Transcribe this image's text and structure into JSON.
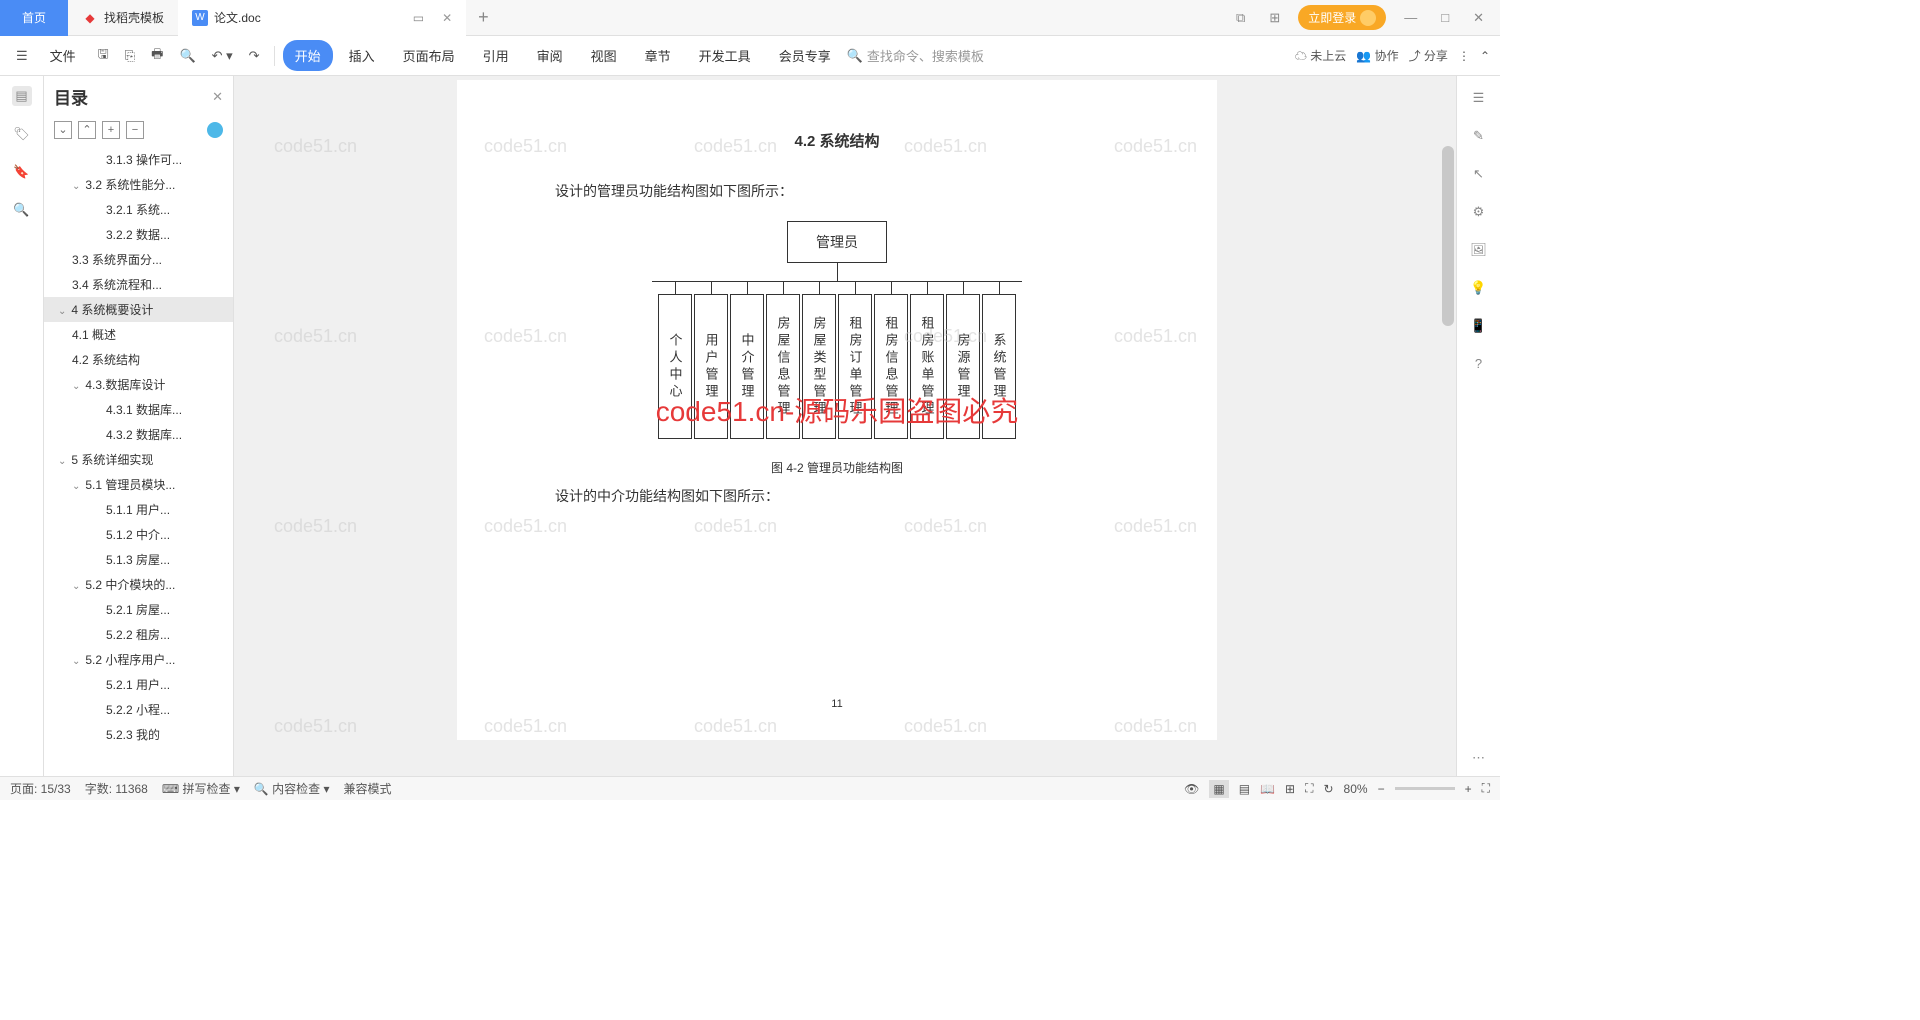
{
  "tabs": {
    "home": "首页",
    "t1": "找稻壳模板",
    "t2": "论文.doc"
  },
  "titleRight": {
    "login": "立即登录"
  },
  "menu": {
    "file": "文件",
    "start": "开始",
    "insert": "插入",
    "layout": "页面布局",
    "ref": "引用",
    "review": "审阅",
    "view": "视图",
    "chapter": "章节",
    "dev": "开发工具",
    "member": "会员专享",
    "search": "查找命令、搜索模板",
    "cloud": "未上云",
    "collab": "协作",
    "share": "分享"
  },
  "outline": {
    "title": "目录"
  },
  "toc": [
    {
      "lv": 4,
      "t": "3.1.3 操作可..."
    },
    {
      "lv": 2,
      "t": "3.2 系统性能分...",
      "c": 1
    },
    {
      "lv": 4,
      "t": "3.2.1 系统..."
    },
    {
      "lv": 4,
      "t": "3.2.2 数据..."
    },
    {
      "lv": 2,
      "t": "3.3 系统界面分..."
    },
    {
      "lv": 2,
      "t": "3.4 系统流程和..."
    },
    {
      "lv": 1,
      "t": "4 系统概要设计",
      "c": 1,
      "sel": 1
    },
    {
      "lv": 2,
      "t": "4.1 概述"
    },
    {
      "lv": 2,
      "t": "4.2 系统结构"
    },
    {
      "lv": 2,
      "t": "4.3.数据库设计",
      "c": 1
    },
    {
      "lv": 4,
      "t": "4.3.1 数据库..."
    },
    {
      "lv": 4,
      "t": "4.3.2 数据库..."
    },
    {
      "lv": 1,
      "t": "5 系统详细实现",
      "c": 1
    },
    {
      "lv": 2,
      "t": "5.1 管理员模块...",
      "c": 1
    },
    {
      "lv": 4,
      "t": "5.1.1 用户..."
    },
    {
      "lv": 4,
      "t": "5.1.2 中介..."
    },
    {
      "lv": 4,
      "t": "5.1.3 房屋..."
    },
    {
      "lv": 2,
      "t": "5.2 中介模块的...",
      "c": 1
    },
    {
      "lv": 4,
      "t": "5.2.1 房屋..."
    },
    {
      "lv": 4,
      "t": "5.2.2 租房..."
    },
    {
      "lv": 2,
      "t": "5.2 小程序用户...",
      "c": 1
    },
    {
      "lv": 4,
      "t": "5.2.1 用户..."
    },
    {
      "lv": 4,
      "t": "5.2.2 小程..."
    },
    {
      "lv": 4,
      "t": "5.2.3 我的"
    }
  ],
  "doc": {
    "heading": "4.2 系统结构",
    "p1": "设计的管理员功能结构图如下图所示：",
    "admin": "管理员",
    "cols": [
      "个人中心",
      "用户管理",
      "中介管理",
      "房屋信息管理",
      "房屋类型管理",
      "租房订单管理",
      "租房信息管理",
      "租房账单管理",
      "房源管理",
      "系统管理"
    ],
    "caption": "图 4-2 管理员功能结构图",
    "p2": "设计的中介功能结构图如下图所示：",
    "wm": "code51.cn-源码乐园盗图必究",
    "wml": "code51.cn",
    "pagenum": "11"
  },
  "status": {
    "page": "页面: 15/33",
    "words": "字数: 11368",
    "spell": "拼写检查",
    "content": "内容检查",
    "compat": "兼容模式",
    "zoom": "80%"
  }
}
